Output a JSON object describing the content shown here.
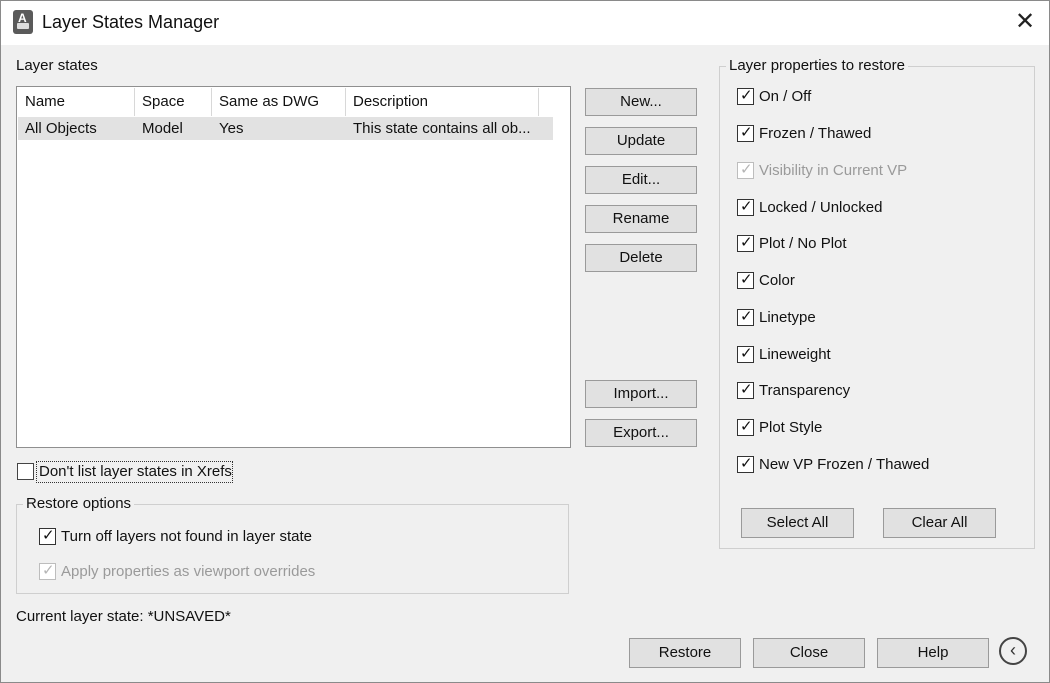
{
  "window": {
    "title": "Layer States Manager",
    "close_glyph": "✕",
    "icon": "autocad-app-icon"
  },
  "layer_states": {
    "label": "Layer states",
    "columns": [
      "Name",
      "Space",
      "Same as DWG",
      "Description"
    ],
    "rows": [
      {
        "name": "All Objects",
        "space": "Model",
        "same_as_dwg": "Yes",
        "description": "This state contains all ob..."
      }
    ]
  },
  "buttons": {
    "new": "New...",
    "update": "Update",
    "edit": "Edit...",
    "rename": "Rename",
    "delete": "Delete",
    "import": "Import...",
    "export": "Export..."
  },
  "xrefs": {
    "label": "Don't list layer states in Xrefs",
    "checked": false
  },
  "restore_options": {
    "title": "Restore options",
    "turn_off": {
      "label": "Turn off layers not found in layer state",
      "checked": true
    },
    "apply_vp": {
      "label": "Apply properties as viewport overrides",
      "checked": true,
      "disabled": true
    }
  },
  "current_state": "Current layer state: *UNSAVED*",
  "properties": {
    "title": "Layer properties to restore",
    "items": [
      {
        "label": "On / Off",
        "checked": true
      },
      {
        "label": "Frozen / Thawed",
        "checked": true
      },
      {
        "label": "Visibility in Current VP",
        "checked": true,
        "disabled": true
      },
      {
        "label": "Locked / Unlocked",
        "checked": true
      },
      {
        "label": "Plot / No Plot",
        "checked": true
      },
      {
        "label": "Color",
        "checked": true
      },
      {
        "label": "Linetype",
        "checked": true
      },
      {
        "label": "Lineweight",
        "checked": true
      },
      {
        "label": "Transparency",
        "checked": true
      },
      {
        "label": "Plot Style",
        "checked": true
      },
      {
        "label": "New VP Frozen / Thawed",
        "checked": true
      }
    ],
    "select_all": "Select All",
    "clear_all": "Clear All"
  },
  "footer": {
    "restore": "Restore",
    "close": "Close",
    "help": "Help",
    "collapse_glyph": "‹"
  },
  "colors": {
    "dialog_bg": "#f0f0f0",
    "button_bg": "#e1e1e1",
    "selected_row": "#e2e2e2",
    "disabled_text": "#9a9a9a"
  }
}
